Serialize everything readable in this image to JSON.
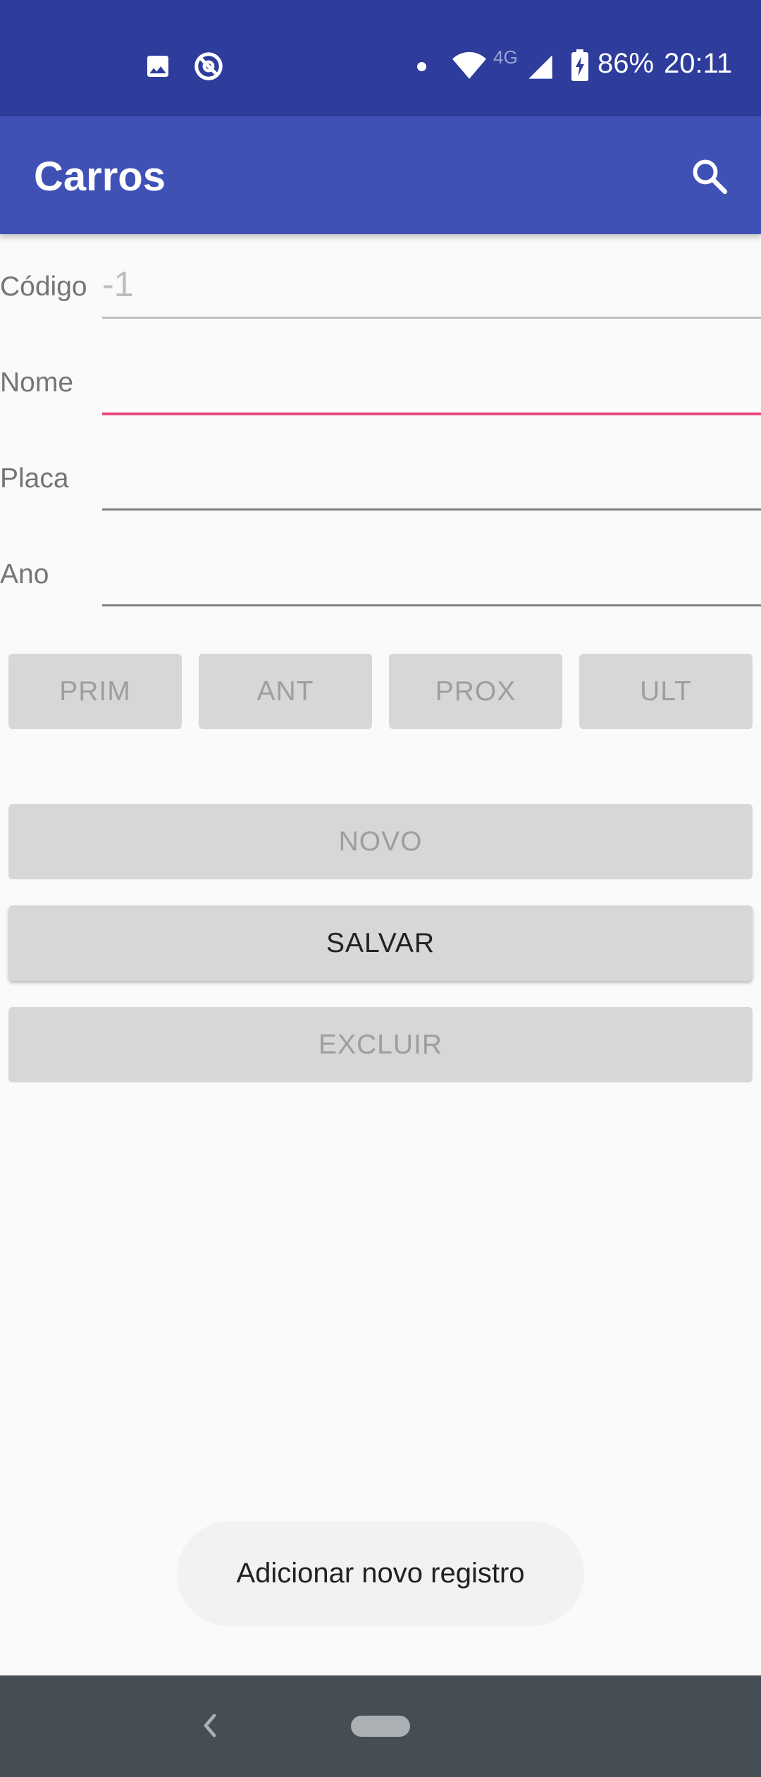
{
  "status_bar": {
    "network_type": "4G",
    "battery_percent": "86%",
    "clock": "20:11",
    "icons": [
      "image-icon",
      "sync-icon",
      "notification-dot",
      "wifi-icon",
      "signal-icon",
      "battery-charging-icon"
    ]
  },
  "app_bar": {
    "title": "Carros",
    "search_icon": "search-icon"
  },
  "form": {
    "codigo": {
      "label": "Código",
      "placeholder": "-1",
      "value": ""
    },
    "nome": {
      "label": "Nome",
      "value": ""
    },
    "placa": {
      "label": "Placa",
      "value": ""
    },
    "ano": {
      "label": "Ano",
      "value": ""
    }
  },
  "navigation_buttons": {
    "first": "PRIM",
    "previous": "ANT",
    "next": "PROX",
    "last": "ULT"
  },
  "actions": {
    "new": "NOVO",
    "save": "SALVAR",
    "delete": "EXCLUIR"
  },
  "toast": {
    "message": "Adicionar novo registro"
  },
  "colors": {
    "status_bar": "#2e3c9c",
    "app_bar": "#3f51b5",
    "accent": "#e8467c",
    "button_bg": "#d6d7d7",
    "nav_bar": "#454e54"
  }
}
